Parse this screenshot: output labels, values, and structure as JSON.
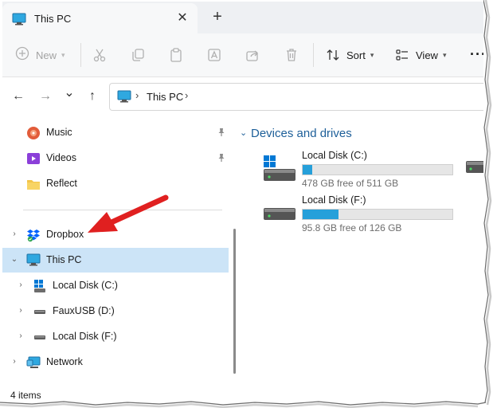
{
  "window": {
    "tab_title": "This PC",
    "tab_close": "✕",
    "new_tab": "+"
  },
  "toolbar": {
    "new_label": "New",
    "sort_label": "Sort",
    "view_label": "View",
    "more_label": "···"
  },
  "address": {
    "back": "←",
    "forward": "→",
    "recent": "⌄",
    "up": "↑",
    "path": "This PC",
    "separator": "›"
  },
  "nav": {
    "quick_access": [
      {
        "label": "Music",
        "icon": "music-icon"
      },
      {
        "label": "Videos",
        "icon": "videos-icon"
      },
      {
        "label": "Reflect",
        "icon": "folder-icon"
      }
    ],
    "tree": [
      {
        "label": "Dropbox",
        "icon": "dropbox-icon",
        "expander": "›"
      },
      {
        "label": "This PC",
        "icon": "this-pc-icon",
        "expander": "⌄",
        "selected": true
      },
      {
        "label": "Local Disk (C:)",
        "icon": "windows-drive-icon",
        "expander": "›"
      },
      {
        "label": "FauxUSB (D:)",
        "icon": "usb-drive-icon",
        "expander": "›"
      },
      {
        "label": "Local Disk (F:)",
        "icon": "drive-icon",
        "expander": "›"
      },
      {
        "label": "Network",
        "icon": "network-icon",
        "expander": "›"
      }
    ]
  },
  "content": {
    "group_title": "Devices and drives",
    "group_chevron": "⌄",
    "drives": [
      {
        "name": "Local Disk (C:)",
        "free": "478 GB free of 511 GB",
        "used_fraction": 0.065
      },
      {
        "name": "Local Disk (F:)",
        "free": "95.8 GB free of 126 GB",
        "used_fraction": 0.24
      }
    ]
  },
  "status": {
    "items": "4 items"
  },
  "colors": {
    "accent": "#26a0da",
    "selection": "#cce4f7",
    "group_heading": "#1d5f99",
    "annotation_arrow": "#e02020"
  }
}
